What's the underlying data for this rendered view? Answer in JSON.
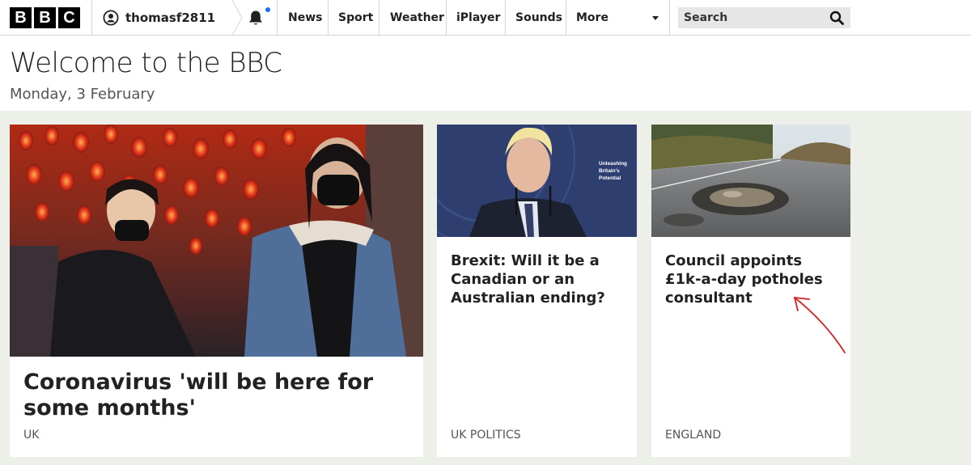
{
  "nav": {
    "logo_letters": [
      "B",
      "B",
      "C"
    ],
    "account_name": "thomasf2811",
    "links": [
      "News",
      "Sport",
      "Weather",
      "iPlayer",
      "Sounds",
      "More"
    ],
    "search_placeholder": "Search"
  },
  "header": {
    "title": "Welcome to the BBC",
    "date": "Monday, 3 February"
  },
  "cards": [
    {
      "headline": "Coronavirus 'will be here for some months'",
      "category": "UK"
    },
    {
      "headline": "Brexit: Will it be a Canadian or an Australian ending?",
      "category": "UK Politics",
      "image_text": "Unleashing Britain's Potential"
    },
    {
      "headline": "Council appoints £1k-a-day potholes consultant",
      "category": "England"
    }
  ],
  "colors": {
    "notification_dot": "#1a6ef2",
    "annotation_arrow": "#d42020",
    "content_background": "#edefe9"
  }
}
